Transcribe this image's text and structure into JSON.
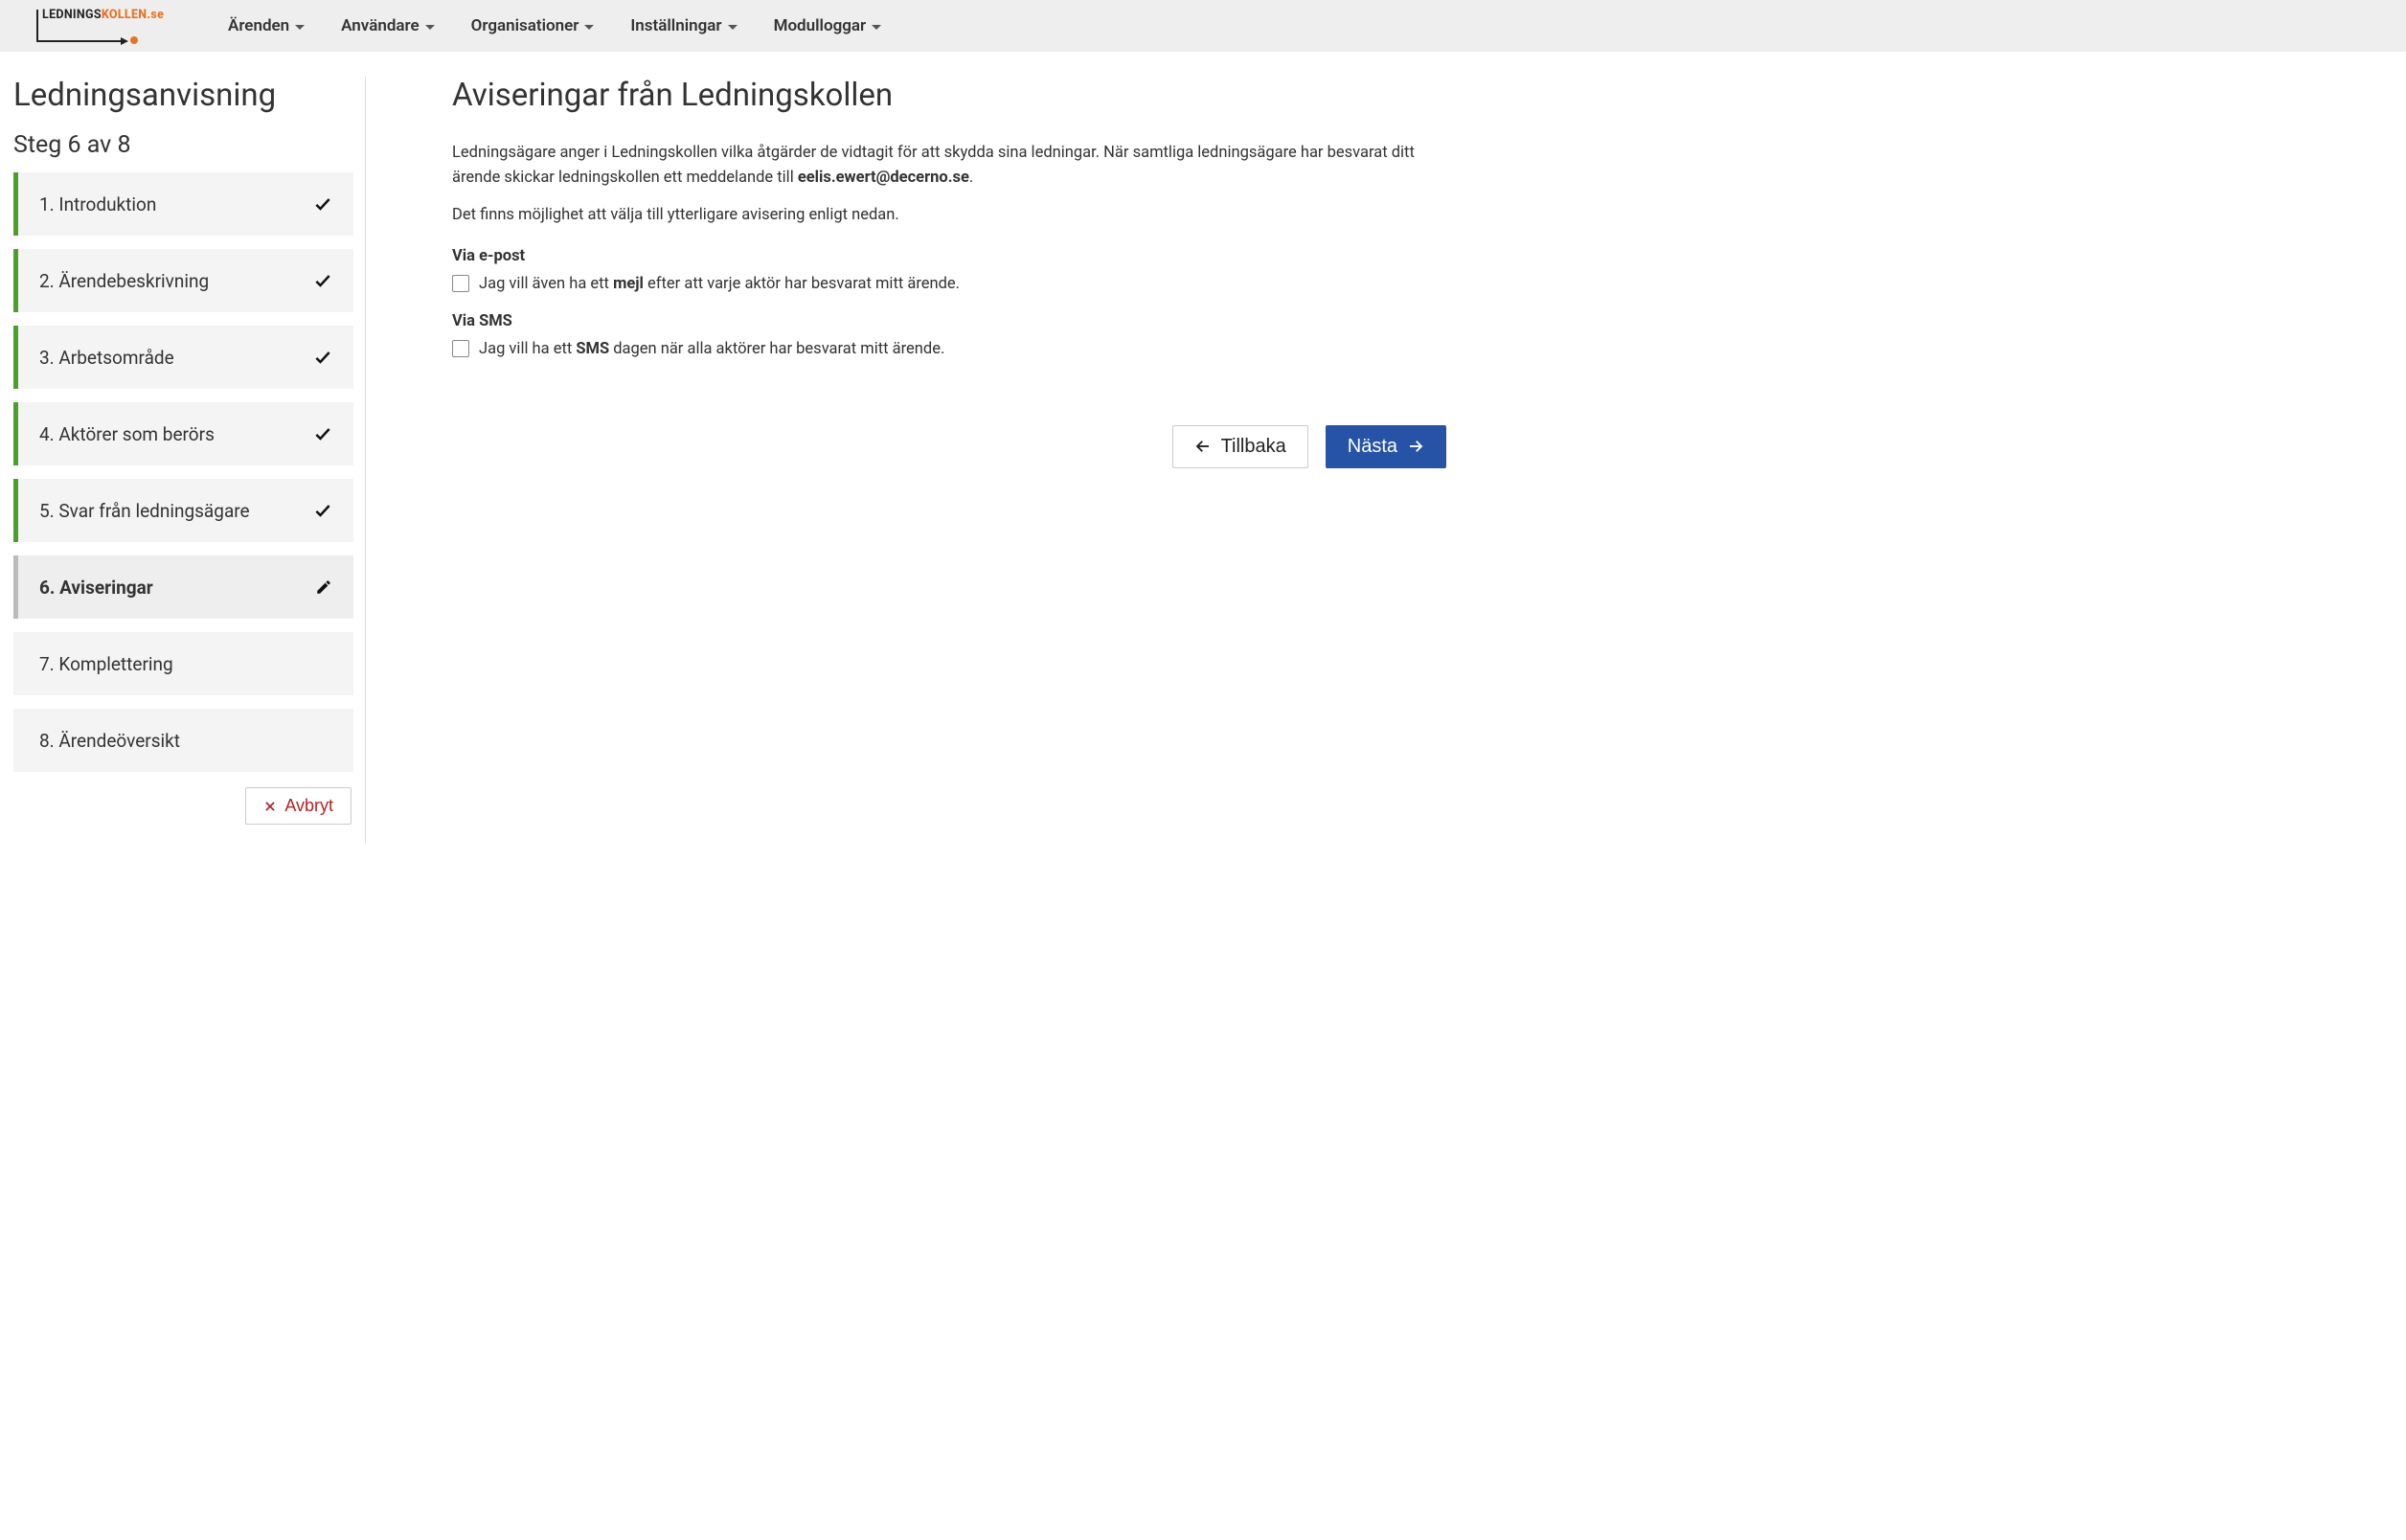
{
  "brand": {
    "text_black": "LEDNINGS",
    "text_orange": "KOLLEN.se"
  },
  "nav": [
    {
      "label": "Ärenden"
    },
    {
      "label": "Användare"
    },
    {
      "label": "Organisationer"
    },
    {
      "label": "Inställningar"
    },
    {
      "label": "Modulloggar"
    }
  ],
  "sidebar": {
    "title": "Ledningsanvisning",
    "step_title": "Steg 6 av 8",
    "steps": [
      {
        "label": "1. Introduktion",
        "state": "done"
      },
      {
        "label": "2. Ärendebeskrivning",
        "state": "done"
      },
      {
        "label": "3. Arbetsområde",
        "state": "done"
      },
      {
        "label": "4. Aktörer som berörs",
        "state": "done"
      },
      {
        "label": "5. Svar från ledningsägare",
        "state": "done"
      },
      {
        "label": "6. Aviseringar",
        "state": "active"
      },
      {
        "label": "7. Komplettering",
        "state": "pending"
      },
      {
        "label": "8. Ärendeöversikt",
        "state": "pending"
      }
    ],
    "cancel_label": "Avbryt"
  },
  "main": {
    "title": "Aviseringar från Ledningskollen",
    "intro_pre": "Ledningsägare anger i Ledningskollen vilka åtgärder de vidtagit för att skydda sina ledningar. När samtliga ledningsägare har besvarat ditt ärende skickar ledningskollen ett meddelande till ",
    "intro_email": "eelis.ewert@decerno.se",
    "intro_post": ".",
    "extra_line": "Det finns möjlighet att välja till ytterligare avisering enligt nedan.",
    "email_section_title": "Via e-post",
    "email_checkbox_pre": "Jag vill även ha ett ",
    "email_checkbox_bold": "mejl",
    "email_checkbox_post": " efter att varje aktör har besvarat mitt ärende.",
    "sms_section_title": "Via SMS",
    "sms_checkbox_pre": "Jag vill ha ett ",
    "sms_checkbox_bold": "SMS",
    "sms_checkbox_post": " dagen när alla aktörer har besvarat mitt ärende.",
    "back_label": "Tillbaka",
    "next_label": "Nästa"
  }
}
